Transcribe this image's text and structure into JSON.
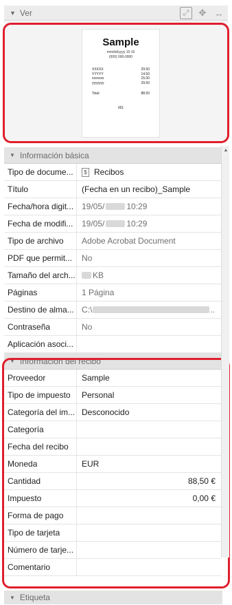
{
  "ver": {
    "title": "Ver"
  },
  "preview": {
    "receipt": {
      "title": "Sample",
      "datetime": "mm/dd/yyyy 15:15",
      "phone": "(000) 000-0000",
      "items": [
        {
          "name": "XXXXX",
          "amount": "29.50"
        },
        {
          "name": "YYYYY",
          "amount": "14.50"
        },
        {
          "name": "xxxxxxx",
          "amount": "15.00"
        },
        {
          "name": "yyyyyyy",
          "amount": "29.50"
        }
      ],
      "total_label": "Total",
      "total_amount": "88.50",
      "number": "001"
    }
  },
  "basic": {
    "title": "Información básica",
    "rows": [
      {
        "label": "Tipo de docume...",
        "value": "Recibos"
      },
      {
        "label": "Título",
        "value": "(Fecha en un recibo)_Sample"
      },
      {
        "label": "Fecha/hora digit...",
        "value_a": "19/05/",
        "value_b": "10:29"
      },
      {
        "label": "Fecha de modifi...",
        "value_a": "19/05/",
        "value_b": "10:29"
      },
      {
        "label": "Tipo de archivo",
        "value": "Adobe Acrobat Document"
      },
      {
        "label": "PDF que permit...",
        "value": "No"
      },
      {
        "label": "Tamaño del arch...",
        "value": "KB"
      },
      {
        "label": "Páginas",
        "value": "1 Página"
      },
      {
        "label": "Destino de alma...",
        "value": "C:\\",
        "value_end": ".."
      },
      {
        "label": "Contraseña",
        "value": "No"
      },
      {
        "label": "Aplicación asoci...",
        "value": ""
      }
    ]
  },
  "receipt_info": {
    "title": "Información del recibo",
    "rows": [
      {
        "label": "Proveedor",
        "value": "Sample"
      },
      {
        "label": "Tipo de impuesto",
        "value": "Personal"
      },
      {
        "label": "Categoría del im...",
        "value": "Desconocido"
      },
      {
        "label": "Categoría",
        "value": ""
      },
      {
        "label": "Fecha del recibo",
        "value": ""
      },
      {
        "label": "Moneda",
        "value": "EUR"
      },
      {
        "label": "Cantidad",
        "value": "88,50 €"
      },
      {
        "label": "Impuesto",
        "value": "0,00 €"
      },
      {
        "label": "Forma de pago",
        "value": ""
      },
      {
        "label": "Tipo de tarjeta",
        "value": ""
      },
      {
        "label": "Número de tarje...",
        "value": ""
      },
      {
        "label": "Comentario",
        "value": ""
      }
    ]
  },
  "etiqueta": {
    "title": "Etiqueta"
  },
  "colors": {
    "highlight": "#e01e2d",
    "header_bg": "#e3e3e3"
  },
  "icons": [
    "triangle-down-icon",
    "zoom-icon",
    "move-icon",
    "fit-width-icon",
    "document-icon",
    "scroll-up-icon"
  ]
}
